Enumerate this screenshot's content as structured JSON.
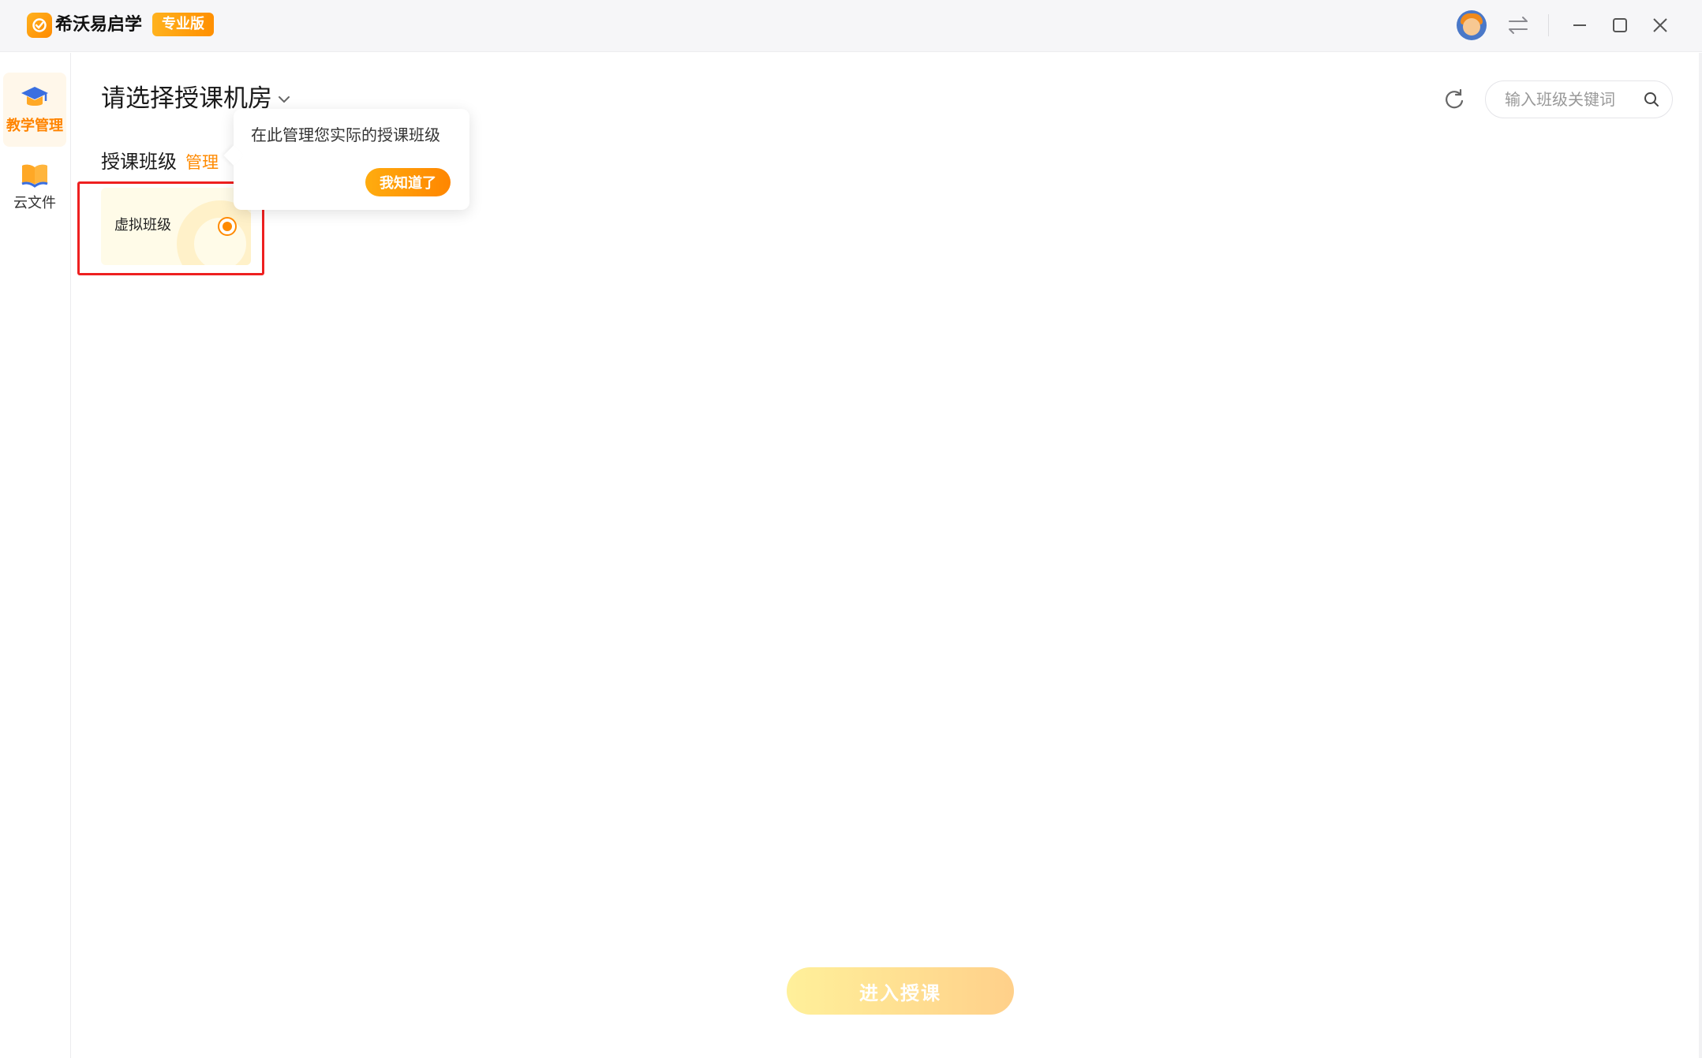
{
  "app": {
    "name": "希沃易启学",
    "edition_badge": "专业版",
    "brand_color": "#ff8a00"
  },
  "titlebar": {
    "icons": [
      "avatar",
      "switch-icon",
      "minimize-icon",
      "maximize-icon",
      "close-icon"
    ]
  },
  "sidebar": {
    "items": [
      {
        "label": "教学管理",
        "icon": "graduation-cap-icon",
        "active": true
      },
      {
        "label": "云文件",
        "icon": "open-book-icon",
        "active": false
      }
    ],
    "footer_icon": "settings-gear-icon"
  },
  "main": {
    "room_selector": "请选择授课机房",
    "search": {
      "placeholder": "输入班级关键词",
      "value": ""
    },
    "section_label": "授课班级",
    "manage_link": "管理",
    "classes": [
      {
        "name": "虚拟班级",
        "selected": true
      }
    ],
    "tooltip": {
      "message": "在此管理您实际的授课班级",
      "confirm_label": "我知道了"
    },
    "enter_button": "进入授课"
  }
}
